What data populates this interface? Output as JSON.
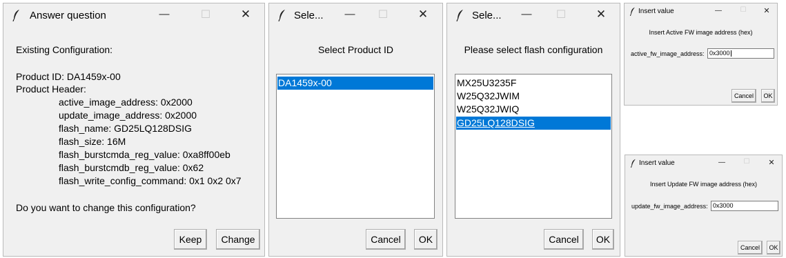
{
  "answer_dialog": {
    "title": "Answer question",
    "minimize": "—",
    "maximize": "☐",
    "close": "✕",
    "heading": "Existing Configuration:",
    "product_id": "Product ID: DA1459x-00",
    "product_header": "Product Header:",
    "fields": [
      "active_image_address: 0x2000",
      "update_image_address: 0x2000",
      "flash_name: GD25LQ128DSIG",
      "flash_size: 16M",
      "flash_burstcmda_reg_value: 0xa8ff00eb",
      "flash_burstcmdb_reg_value: 0x62",
      "flash_write_config_command: 0x1 0x2 0x7"
    ],
    "question": "Do you want to change this configuration?",
    "keep_label": "Keep",
    "change_label": "Change"
  },
  "product_dialog": {
    "title": "Sele...",
    "minimize": "—",
    "maximize": "☐",
    "close": "✕",
    "prompt": "Select Product ID",
    "items": [
      "DA1459x-00"
    ],
    "cancel_label": "Cancel",
    "ok_label": "OK"
  },
  "flash_dialog": {
    "title": "Sele...",
    "minimize": "—",
    "maximize": "☐",
    "close": "✕",
    "prompt": "Please select flash configuration",
    "items": [
      "MX25U3235F",
      "W25Q32JWIM",
      "W25Q32JWIQ",
      "GD25LQ128DSIG"
    ],
    "cancel_label": "Cancel",
    "ok_label": "OK"
  },
  "active_value_dialog": {
    "title": "Insert value",
    "minimize": "—",
    "maximize": "☐",
    "close": "✕",
    "prompt": "Insert Active FW image address (hex)",
    "field_label": "active_fw_image_address:",
    "field_value": "0x3000",
    "cancel_label": "Cancel",
    "ok_label": "OK"
  },
  "update_value_dialog": {
    "title": "Insert value",
    "minimize": "—",
    "maximize": "☐",
    "close": "✕",
    "prompt": "Insert Update FW image address (hex)",
    "field_label": "update_fw_image_address:",
    "field_value": "0x3000",
    "cancel_label": "Cancel",
    "ok_label": "OK"
  }
}
